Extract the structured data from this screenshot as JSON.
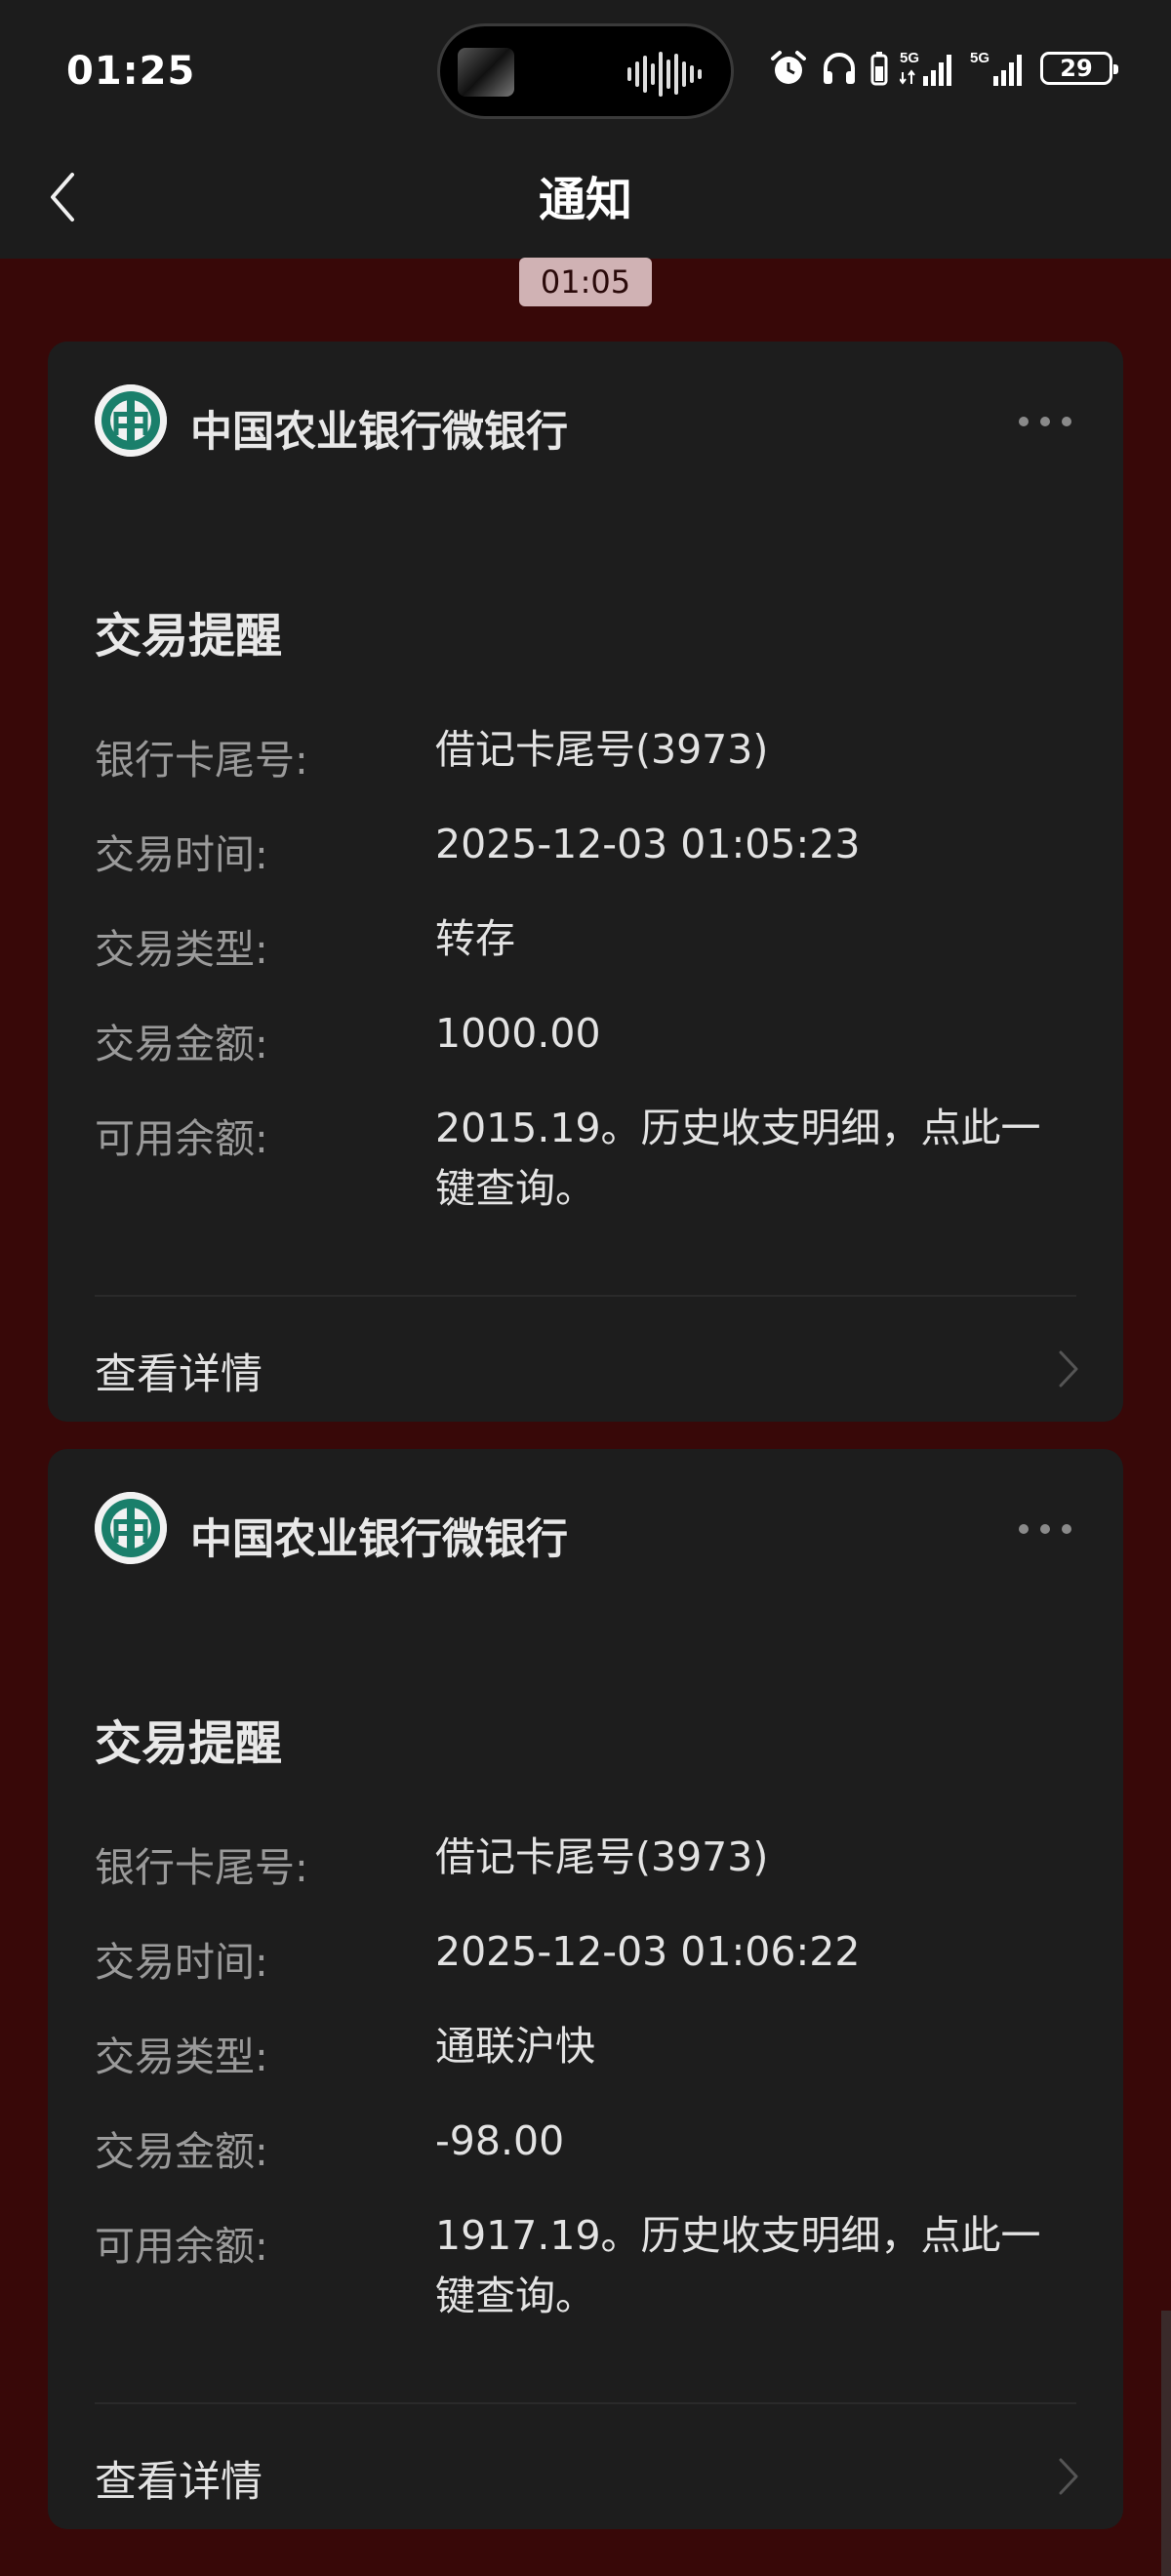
{
  "status_bar": {
    "time": "01:25",
    "battery": "29",
    "network_labels": [
      "5G",
      "5G"
    ]
  },
  "nav": {
    "title": "通知",
    "back_icon": "chevron-left-icon"
  },
  "timestamp": "01:05",
  "notifications": [
    {
      "sender": "中国农业银行微银行",
      "title": "交易提醒",
      "rows": [
        {
          "label": "银行卡尾号:",
          "value": "借记卡尾号(3973)"
        },
        {
          "label": "交易时间:",
          "value": "2025-12-03 01:05:23"
        },
        {
          "label": "交易类型:",
          "value": "转存"
        },
        {
          "label": "交易金额:",
          "value": "1000.00"
        },
        {
          "label": "可用余额:",
          "value": "2015.19。历史收支明细，点此一键查询。"
        }
      ],
      "detail_label": "查看详情"
    },
    {
      "sender": "中国农业银行微银行",
      "title": "交易提醒",
      "rows": [
        {
          "label": "银行卡尾号:",
          "value": "借记卡尾号(3973)"
        },
        {
          "label": "交易时间:",
          "value": "2025-12-03 01:06:22"
        },
        {
          "label": "交易类型:",
          "value": "通联沪快"
        },
        {
          "label": "交易金额:",
          "value": "-98.00"
        },
        {
          "label": "可用余额:",
          "value": "1917.19。历史收支明细，点此一键查询。"
        }
      ],
      "detail_label": "查看详情"
    }
  ],
  "colors": {
    "background": "#380808",
    "card": "#1d1d1d",
    "bar": "#1c1c1c",
    "logo_green": "#1a7f6b"
  }
}
